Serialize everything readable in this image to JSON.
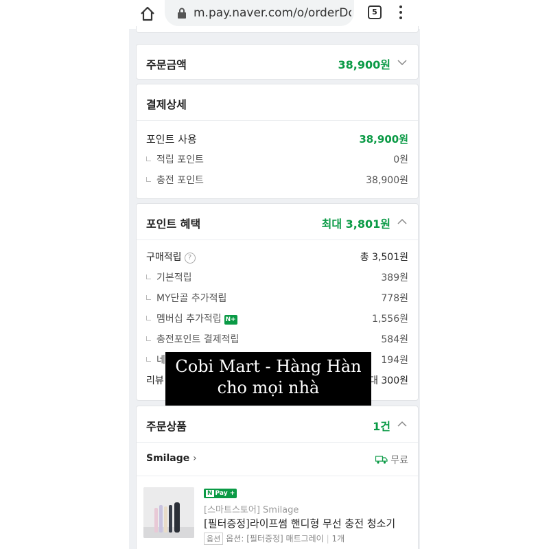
{
  "browser": {
    "url": "m.pay.naver.com/o/orderDone",
    "tab_count": "5"
  },
  "order_amount": {
    "title": "주문금액",
    "amount": "38,900원"
  },
  "payment_details": {
    "title": "결제상세",
    "rows": [
      {
        "label": "포인트 사용",
        "value": "38,900원"
      },
      {
        "label": "적립 포인트",
        "value": "0원"
      },
      {
        "label": "충전 포인트",
        "value": "38,900원"
      }
    ]
  },
  "point_benefits": {
    "title": "포인트 혜택",
    "amount": "최대 3,801원",
    "rows": [
      {
        "label": "구매적립",
        "value": "총 3,501원"
      },
      {
        "label": "기본적립",
        "value": "389원"
      },
      {
        "label": "MY단골 추가적립",
        "value": "778원"
      },
      {
        "label": "멤버십 추가적립",
        "value": "1,556원"
      },
      {
        "label": "충전포인트 결제적립",
        "value": "584원"
      },
      {
        "label": "네",
        "value": "194원"
      },
      {
        "label": "리뷰",
        "value": "대 300원"
      }
    ],
    "help_icon": "?",
    "npay_plus": "N+"
  },
  "order_items": {
    "title": "주문상품",
    "count": "1건",
    "shop": "Smilage",
    "shipping": "무료",
    "product": {
      "badge_n": "N",
      "badge_text": "Pay +",
      "store": "[스마트스토어] Smilage",
      "name": "[필터증정]라이프썸 핸디형 무선 충전 청소기",
      "option_tag": "옵션",
      "option": "옵션: [필터증정] 매트그레이",
      "quantity": "1개"
    }
  },
  "overlay": {
    "line1": "Cobi Mart - Hàng Hàn",
    "line2": "cho mọi nhà"
  },
  "colors": {
    "accent_green": "#0a9a45",
    "background": "#eef0f3"
  }
}
